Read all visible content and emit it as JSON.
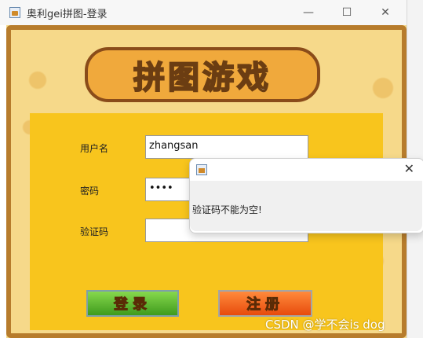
{
  "window": {
    "title": "奥利gei拼图-登录",
    "minimize_label": "—",
    "maximize_label": "☐",
    "close_label": "✕"
  },
  "logo": {
    "text": "拼图游戏"
  },
  "form": {
    "username_label": "用户名",
    "username_value": "zhangsan",
    "password_label": "密码",
    "password_value": "••••",
    "captcha_label": "验证码",
    "captcha_value": "",
    "login_button": "登录",
    "register_button": "注册"
  },
  "dialog": {
    "close_label": "✕",
    "message": "验证码不能为空!"
  },
  "watermark": "CSDN @学不会is dog",
  "colors": {
    "panel": "#f8c51d",
    "login_green": "#3f9b1d",
    "register_orange": "#e74b0c"
  },
  "icons": [
    "app-icon",
    "minimize-icon",
    "maximize-icon",
    "close-icon",
    "dialog-app-icon",
    "dialog-close-icon"
  ]
}
